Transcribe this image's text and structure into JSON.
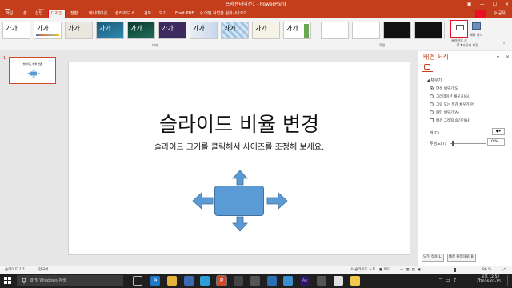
{
  "titlebar": {
    "title": "프레젠테이션1 - PowerPoint",
    "controls": [
      "—",
      "☐",
      "✕"
    ]
  },
  "tabs": [
    {
      "label": "파일"
    },
    {
      "label": "홈"
    },
    {
      "label": "삽입"
    },
    {
      "label": "디자인",
      "active": true
    },
    {
      "label": "전환"
    },
    {
      "label": "애니메이션"
    },
    {
      "label": "슬라이드 쇼"
    },
    {
      "label": "검토"
    },
    {
      "label": "보기"
    },
    {
      "label": "Foxit PDF"
    }
  ],
  "tell_me": "♀ 어떤 작업을 원하시나요?",
  "share": "♀ 공유",
  "ribbon": {
    "themes_label": "테마",
    "variants_label": "적용",
    "customize_label": "사용자 지정",
    "theme_tile_text": "가가",
    "slide_size_label": "슬라이드 크기 ▾",
    "bg_format_label": "배경 서식"
  },
  "thumbnail": {
    "number": "1",
    "title": "슬라이드 비율 변경"
  },
  "slide": {
    "title": "슬라이드 비율 변경",
    "subtitle": "슬라이드 크기를 클릭해서 사이즈를 조정해 보세요."
  },
  "format_pane": {
    "title": "배경 서식",
    "fill_header": "◢ 채우기",
    "options": [
      {
        "label": "단색 채우기(S)",
        "selected": true
      },
      {
        "label": "그라데이션 채우기(G)",
        "selected": false
      },
      {
        "label": "그림 또는 질감 채우기(P)",
        "selected": false
      },
      {
        "label": "패턴 채우기(A)",
        "selected": false
      }
    ],
    "hide_bg_graphics": "배경 그래픽 숨기기(H)",
    "color_label": "색(C)",
    "transparency_label": "투명도(T)",
    "transparency_value": "0 %",
    "apply_all": "모두 적용(L)",
    "reset_bg": "배경 원래대로(B)"
  },
  "statusbar": {
    "slide_info": "슬라이드 1/1",
    "language": "한국어",
    "notes": "≜ 슬라이드 노트",
    "comments": "■ 메모",
    "zoom": "86 %"
  },
  "taskbar": {
    "search_placeholder": "웹 및 Windows 검색",
    "ime": "가",
    "time": "오후 12:52",
    "date": "2016-02-15"
  },
  "colors": {
    "accent": "#c43e1c",
    "shape_fill": "#5b9bd5",
    "highlight": "#e81123"
  }
}
